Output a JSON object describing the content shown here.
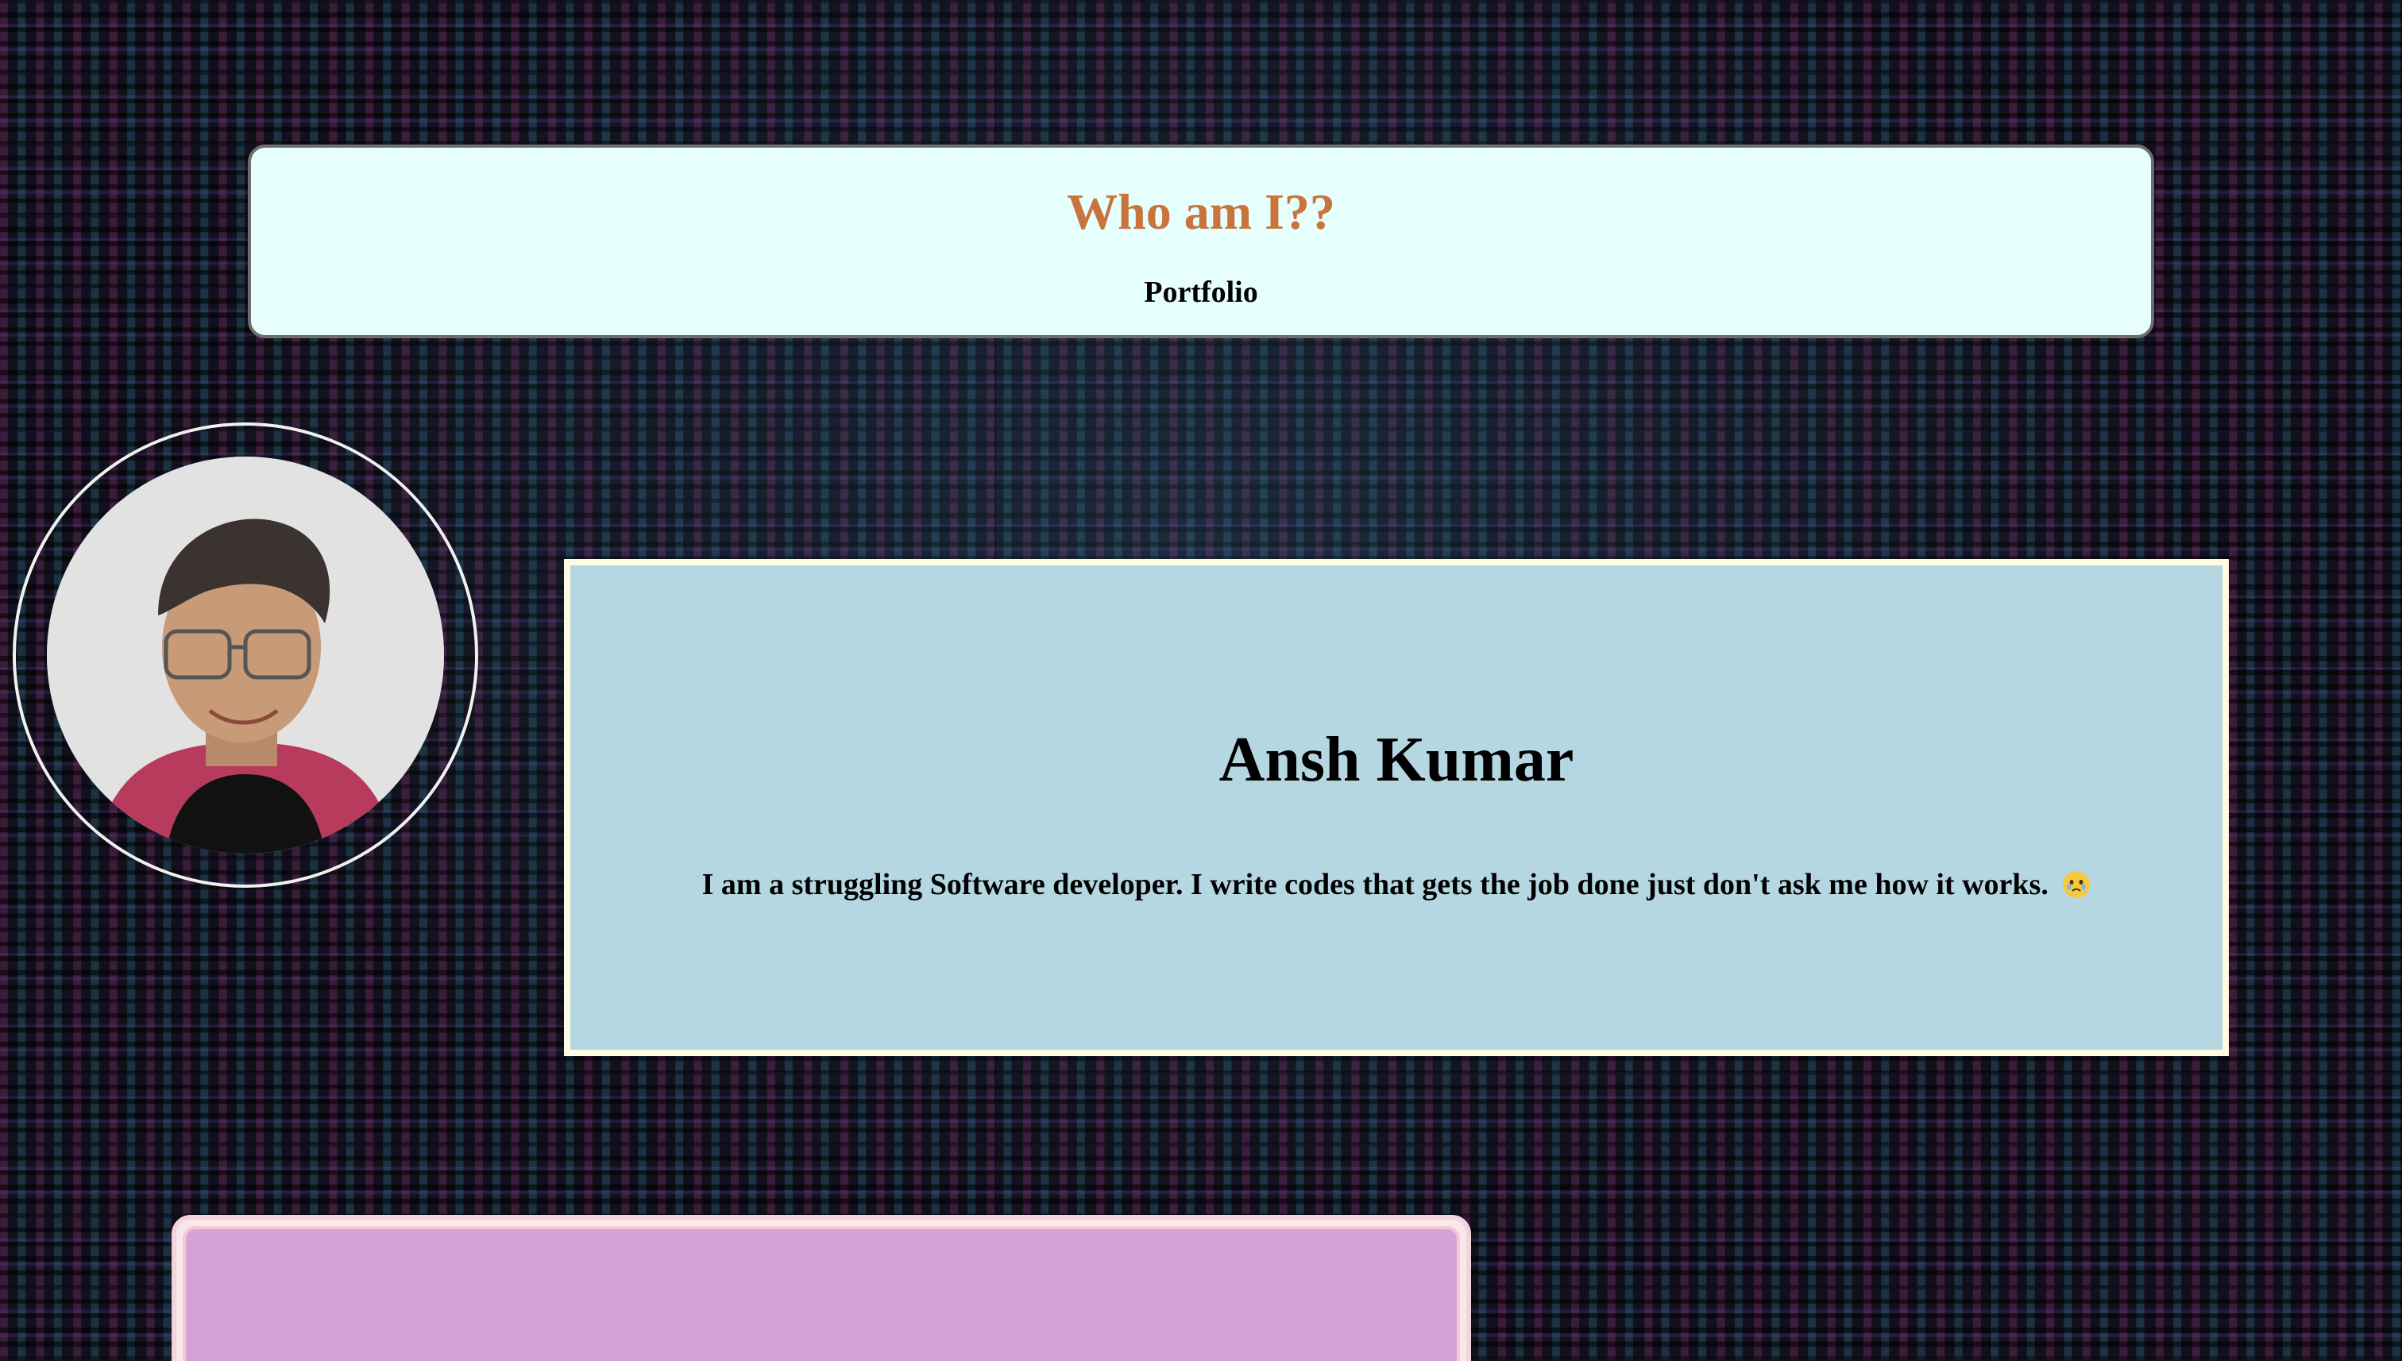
{
  "header": {
    "title": "Who am I??",
    "subtitle": "Portfolio"
  },
  "profile": {
    "photo_icon": "person-photo",
    "name": "Ansh Kumar",
    "bio": "I am a struggling Software developer. I write codes that gets the job done just don't ask me how it works.",
    "bio_emoji_icon": "face-holding-back-tears-icon"
  },
  "colors": {
    "header_bg": "#e6fffd",
    "header_title": "#c8743c",
    "intro_bg": "#b5d7e2",
    "intro_border": "#fffbe0",
    "lower_card_bg": "#d6a2d8"
  }
}
